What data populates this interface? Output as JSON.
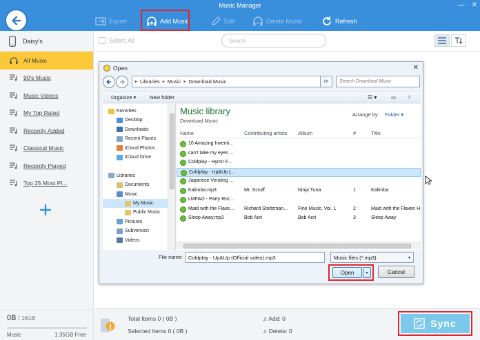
{
  "app": {
    "title": "Music Manager",
    "accent": "#3a8fdd",
    "highlight": "#e0262b",
    "sidebar_active": "#fbc83a"
  },
  "toolbar": {
    "export": "Export",
    "add_music": "Add Music",
    "edit": "Edit",
    "delete_music": "Delete Music",
    "refresh": "Refresh"
  },
  "sidebar": {
    "device_name": "Daisy's",
    "items": [
      {
        "label": "All Music",
        "icon": "headphones-icon"
      },
      {
        "label": "90's Music",
        "icon": "playlist-icon"
      },
      {
        "label": "Music Videos",
        "icon": "playlist-icon"
      },
      {
        "label": "My Top Rated",
        "icon": "playlist-icon"
      },
      {
        "label": "Recently Added",
        "icon": "playlist-icon"
      },
      {
        "label": "Classical Music",
        "icon": "playlist-icon"
      },
      {
        "label": "Recently Played",
        "icon": "playlist-icon"
      },
      {
        "label": "Top 25 Most Pl...",
        "icon": "playlist-icon"
      }
    ]
  },
  "storage": {
    "used": "0B",
    "total": "/ 16GB",
    "kind": "Music",
    "free": "1.35GB Free",
    "used_fraction": 0.0
  },
  "main": {
    "select_all": "Select All",
    "search_placeholder": "Search"
  },
  "summary": {
    "total_items": "Total Items  0  ( 0B )",
    "selected_items": "Selected Items  0  ( 0B )",
    "add": "Add: 0",
    "delete": "Delete: 0",
    "sync": "Sync"
  },
  "dialog": {
    "title": "Open",
    "breadcrumb": [
      "Libraries",
      "Music",
      "Download Music"
    ],
    "search_placeholder": "Search Download Music",
    "organize": "Organize ▾",
    "new_folder": "New folder",
    "nav": [
      {
        "label": "Favorites",
        "level": 0,
        "color": "#f0c23a"
      },
      {
        "label": "Desktop",
        "level": 1,
        "color": "#4a8fd8"
      },
      {
        "label": "Downloads",
        "level": 1,
        "color": "#3b6fb3"
      },
      {
        "label": "Recent Places",
        "level": 1,
        "color": "#7fa4cc"
      },
      {
        "label": "iCloud Photos",
        "level": 1,
        "color": "#e57d3c"
      },
      {
        "label": "iCloud Drive",
        "level": 1,
        "color": "#5aa8e8"
      },
      {
        "label": "",
        "level": 0,
        "color": ""
      },
      {
        "label": "Libraries",
        "level": 0,
        "color": "#8aa7c9"
      },
      {
        "label": "Documents",
        "level": 1,
        "color": "#d8c06a"
      },
      {
        "label": "Music",
        "level": 1,
        "color": "#5b8ec7"
      },
      {
        "label": "My Music",
        "level": 2,
        "color": "#e8c460",
        "selected": true
      },
      {
        "label": "Public Music",
        "level": 2,
        "color": "#e8c460"
      },
      {
        "label": "Pictures",
        "level": 1,
        "color": "#6aa0d8"
      },
      {
        "label": "Subversion",
        "level": 1,
        "color": "#7c9fbf"
      },
      {
        "label": "Videos",
        "level": 1,
        "color": "#5877a8"
      }
    ],
    "library_title": "Music library",
    "library_sub": "Download Music",
    "arrange_by": "Arrange by:",
    "arrange_value": "Folder ▾",
    "columns": [
      "Name",
      "Contributing artists",
      "Album",
      "#",
      "Title"
    ],
    "files": [
      {
        "name": "10 Amazing Inventi...",
        "artist": "",
        "album": "",
        "num": "",
        "title": ""
      },
      {
        "name": "can't take my eyes ...",
        "artist": "",
        "album": "",
        "num": "",
        "title": ""
      },
      {
        "name": "Coldplay - Hymn F...",
        "artist": "",
        "album": "",
        "num": "",
        "title": ""
      },
      {
        "name": "Coldplay - Up&Up (...",
        "artist": "",
        "album": "",
        "num": "",
        "title": "",
        "selected": true
      },
      {
        "name": "Japanese Vending ...",
        "artist": "",
        "album": "",
        "num": "",
        "title": ""
      },
      {
        "name": "Kalimba.mp3",
        "artist": "Mr. Scruff",
        "album": "Ninja Tuna",
        "num": "1",
        "title": "Kalimba"
      },
      {
        "name": "LMFAO - Party Roc...",
        "artist": "",
        "album": "",
        "num": "",
        "title": ""
      },
      {
        "name": "Maid with the Flaxe...",
        "artist": "Richard Stoltzman...",
        "album": "Fine Music, Vol. 1",
        "num": "2",
        "title": "Maid with the Flaxen H"
      },
      {
        "name": "Sleep Away.mp3",
        "artist": "Bob Acri",
        "album": "Bob Acri",
        "num": "3",
        "title": "Sleep Away"
      }
    ],
    "file_name_label": "File name:",
    "file_name_value": "Coldplay - Up&Up (Official video).mp3",
    "file_type": "Music files (*.mp3)",
    "open": "Open",
    "cancel": "Cancel"
  }
}
